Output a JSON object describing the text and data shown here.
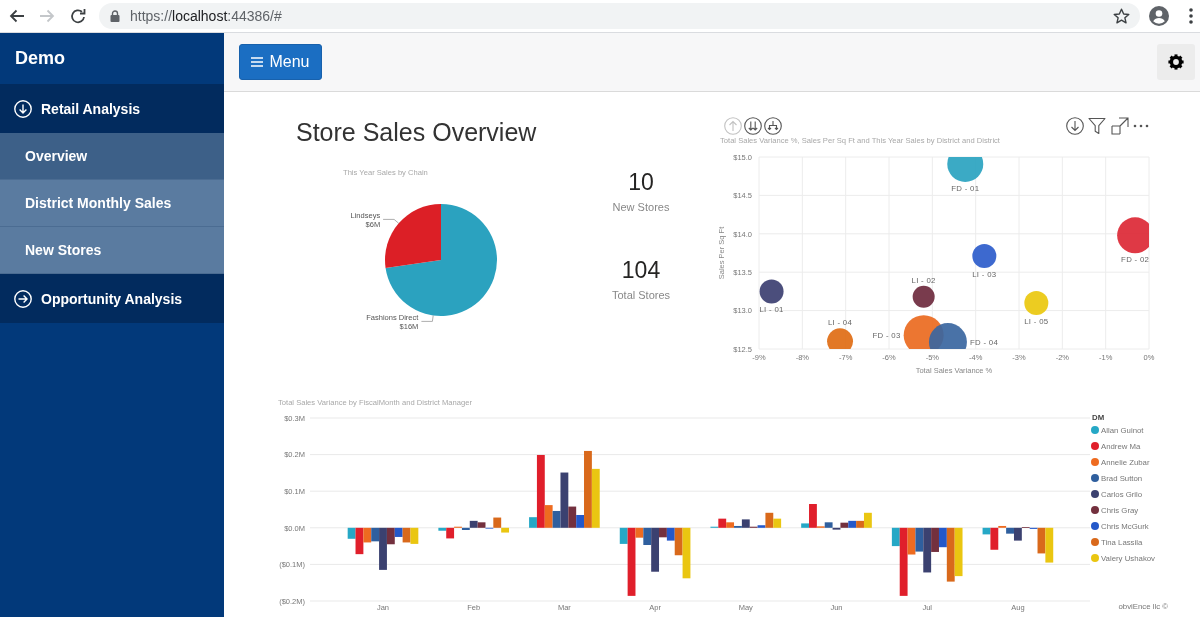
{
  "browser": {
    "nav_buttons": [
      {
        "kind": "back",
        "disabled": false
      },
      {
        "kind": "forward",
        "disabled": true
      },
      {
        "kind": "reload",
        "disabled": false
      }
    ],
    "address": {
      "scheme": "https://",
      "host": "localhost",
      "rest": ":44386/#"
    }
  },
  "sidebar": {
    "brand": "Demo",
    "sections": [
      {
        "label": "Retail Analysis",
        "expanded": true,
        "children": [
          {
            "label": "Overview",
            "selected": true
          },
          {
            "label": "District Monthly Sales",
            "selected": false
          },
          {
            "label": "New Stores",
            "selected": false
          }
        ]
      },
      {
        "label": "Opportunity Analysis",
        "expanded": false
      }
    ]
  },
  "top_bar": {
    "menu_button": "Menu"
  },
  "report": {
    "title": "Store Sales Overview",
    "pie": {
      "chart_data": [
        {
          "type": "pie",
          "title": "This Year Sales by Chain",
          "categories": [
            "Fashions Direct",
            "Lindseys"
          ],
          "values": [
            16,
            6
          ],
          "value_labels": [
            "$16M",
            "$6M"
          ],
          "colors": [
            "#2ba2bf",
            "#dc1f26"
          ]
        }
      ]
    },
    "kpis": [
      {
        "value": "10",
        "label": "New Stores"
      },
      {
        "value": "104",
        "label": "Total Stores"
      }
    ],
    "scatter": {
      "drill_buttons": [
        {
          "kind": "drill-up",
          "disabled": true
        },
        {
          "kind": "drill-down-all",
          "disabled": false
        },
        {
          "kind": "expand-all",
          "disabled": false
        }
      ],
      "chart_data": [
        {
          "type": "scatter",
          "title": "Total Sales Variance %, Sales Per Sq Ft and This Year Sales by District and District",
          "xlabel": "Total Sales Variance %",
          "ylabel": "Sales Per Sq Ft",
          "xlim": [
            -9,
            0
          ],
          "ylim": [
            12.5,
            15
          ],
          "xticks": [
            {
              "value": -9,
              "label": "-9%"
            },
            {
              "value": -8,
              "label": "-8%"
            },
            {
              "value": -7,
              "label": "-7%"
            },
            {
              "value": -6,
              "label": "-6%"
            },
            {
              "value": -5,
              "label": "-5%"
            },
            {
              "value": -4,
              "label": "-4%"
            },
            {
              "value": -3,
              "label": "-3%"
            },
            {
              "value": -2,
              "label": "-2%"
            },
            {
              "value": -1,
              "label": "-1%"
            },
            {
              "value": 0,
              "label": "0%"
            }
          ],
          "yticks": [
            {
              "value": 12.5,
              "label": "$12.5"
            },
            {
              "value": 13,
              "label": "$13.0"
            },
            {
              "value": 13.5,
              "label": "$13.5"
            },
            {
              "value": 14,
              "label": "$14.0"
            },
            {
              "value": 14.5,
              "label": "$14.5"
            },
            {
              "value": 15,
              "label": "$15.0"
            }
          ],
          "grid": true,
          "series": [
            {
              "name": "FD - 01",
              "color": "#2aa3c0",
              "x": [
                -4.24
              ],
              "values": [
                14.91
              ]
            },
            {
              "name": "FD - 02",
              "color": "#dc2835",
              "x": [
                -0.32
              ],
              "values": [
                13.98
              ]
            },
            {
              "name": "FD - 03",
              "color": "#ea6a20",
              "x": [
                -5.2
              ],
              "values": [
                12.68
              ]
            },
            {
              "name": "FD - 04",
              "color": "#3a66a0",
              "x": [
                -4.64
              ],
              "values": [
                12.59
              ]
            },
            {
              "name": "LI - 01",
              "color": "#3c3f71",
              "x": [
                -8.71
              ],
              "values": [
                13.25
              ]
            },
            {
              "name": "LI - 02",
              "color": "#6e2a3e",
              "x": [
                -5.2
              ],
              "values": [
                13.18
              ]
            },
            {
              "name": "LI - 03",
              "color": "#2c5ccb",
              "x": [
                -3.8
              ],
              "values": [
                13.71
              ]
            },
            {
              "name": "LI - 04",
              "color": "#e06c14",
              "x": [
                -7.13
              ],
              "values": [
                12.6
              ]
            },
            {
              "name": "LI - 05",
              "color": "#eac80e",
              "x": [
                -2.6
              ],
              "values": [
                13.1
              ]
            }
          ]
        }
      ]
    },
    "bars": {
      "chart_data": [
        {
          "type": "bar",
          "title": "Total Sales Variance by FiscalMonth and District Manager",
          "categories": [
            "Jan",
            "Feb",
            "Mar",
            "Apr",
            "May",
            "Jun",
            "Jul",
            "Aug"
          ],
          "legend_title": "DM",
          "legend": "right",
          "grid": true,
          "ylim": [
            -0.2,
            0.3
          ],
          "yticks": [
            {
              "value": -0.2,
              "label": "($0.2M)"
            },
            {
              "value": -0.1,
              "label": "($0.1M)"
            },
            {
              "value": 0,
              "label": "$0.0M"
            },
            {
              "value": 0.1,
              "label": "$0.1M"
            },
            {
              "value": 0.2,
              "label": "$0.2M"
            },
            {
              "value": 0.3,
              "label": "$0.3M"
            }
          ],
          "series": [
            {
              "name": "Allan Guinot",
              "color": "#26a8c6",
              "values": [
                -0.03,
                -0.008,
                0.029,
                -0.044,
                0.003,
                0.012,
                -0.05,
                -0.018
              ]
            },
            {
              "name": "Andrew Ma",
              "color": "#e01f2b",
              "values": [
                -0.072,
                -0.029,
                0.199,
                -0.186,
                0.025,
                0.065,
                -0.186,
                -0.06
              ]
            },
            {
              "name": "Annelie Zubar",
              "color": "#ee6b20",
              "values": [
                -0.04,
                0.003,
                0.062,
                -0.027,
                0.015,
                0.004,
                -0.073,
                0.005
              ]
            },
            {
              "name": "Brad Sutton",
              "color": "#2f5f9e",
              "values": [
                -0.037,
                -0.006,
                0.046,
                -0.047,
                0.005,
                0.015,
                -0.065,
                -0.016
              ]
            },
            {
              "name": "Carlos Grilo",
              "color": "#3b4170",
              "values": [
                -0.115,
                0.019,
                0.151,
                -0.12,
                0.023,
                -0.005,
                -0.122,
                -0.035
              ]
            },
            {
              "name": "Chris Gray",
              "color": "#73303e",
              "values": [
                -0.045,
                0.015,
                0.058,
                -0.026,
                0.003,
                0.014,
                -0.066,
                0.002
              ]
            },
            {
              "name": "Chris McGurk",
              "color": "#2458c9",
              "values": [
                -0.025,
                -0.002,
                0.035,
                -0.035,
                0.007,
                0.019,
                -0.053,
                -0.003
              ]
            },
            {
              "name": "Tina Lassila",
              "color": "#d9691b",
              "values": [
                -0.04,
                0.028,
                0.21,
                -0.075,
                0.041,
                0.019,
                -0.147,
                -0.07
              ]
            },
            {
              "name": "Valery Ushakov",
              "color": "#eac611",
              "values": [
                -0.044,
                -0.013,
                0.161,
                -0.138,
                0.025,
                0.041,
                -0.132,
                -0.095
              ]
            }
          ]
        }
      ]
    },
    "credit": "obviEnce llc ©"
  }
}
